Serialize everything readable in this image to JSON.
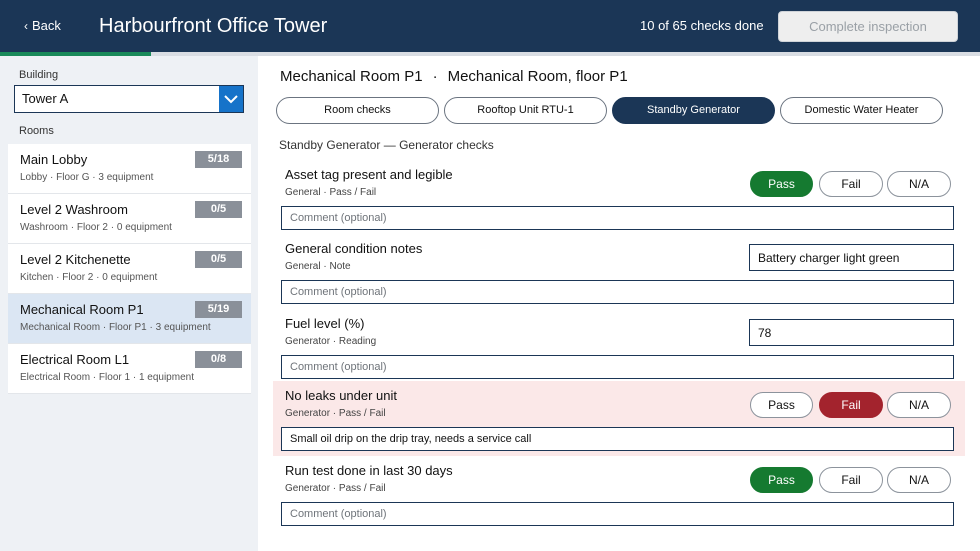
{
  "header": {
    "back_label": "Back",
    "title": "Harbourfront Office Tower",
    "checks_done": "10 of 65 checks done",
    "progress": 0.154,
    "complete_label": "Complete inspection"
  },
  "sidebar": {
    "building_label": "Building",
    "building_value": "Tower A",
    "rooms_label": "Rooms",
    "rooms": [
      {
        "name": "Main Lobby",
        "type": "Lobby",
        "floor": "Floor G",
        "equipment": "3 equipment",
        "count": "5/18"
      },
      {
        "name": "Level 2 Washroom",
        "type": "Washroom",
        "floor": "Floor 2",
        "equipment": "0 equipment",
        "count": "0/5"
      },
      {
        "name": "Level 2 Kitchenette",
        "type": "Kitchen",
        "floor": "Floor 2",
        "equipment": "0 equipment",
        "count": "0/5"
      },
      {
        "name": "Mechanical Room P1",
        "type": "Mechanical Room",
        "floor": "Floor P1",
        "equipment": "3 equipment",
        "count": "5/19"
      },
      {
        "name": "Electrical Room L1",
        "type": "Electrical Room",
        "floor": "Floor 1",
        "equipment": "1 equipment",
        "count": "0/8"
      }
    ]
  },
  "main": {
    "room_name": "Mechanical Room P1",
    "room_desc": "Mechanical Room, floor P1",
    "separator": "·",
    "tabs": [
      {
        "label": "Room checks"
      },
      {
        "label": "Rooftop Unit RTU-1"
      },
      {
        "label": "Standby Generator"
      },
      {
        "label": "Domestic Water Heater"
      }
    ],
    "section_title": "Standby Generator — Generator checks",
    "checks": [
      {
        "title": "Asset tag present and legible",
        "category": "General",
        "kind": "Pass / Fail",
        "pass": "Pass",
        "fail": "Fail",
        "na": "N/A",
        "comment_placeholder": "Comment (optional)"
      },
      {
        "title": "General condition notes",
        "category": "General",
        "kind": "Note",
        "value": "Battery charger light green",
        "comment_placeholder": "Comment (optional)"
      },
      {
        "title": "Fuel level (%)",
        "category": "Generator",
        "kind": "Reading",
        "value": "78",
        "comment_placeholder": "Comment (optional)"
      },
      {
        "title": "No leaks under unit",
        "category": "Generator",
        "kind": "Pass / Fail",
        "pass": "Pass",
        "fail": "Fail",
        "na": "N/A",
        "comment_value": "Small oil drip on the drip tray, needs a service call"
      },
      {
        "title": "Run test done in last 30 days",
        "category": "Generator",
        "kind": "Pass / Fail",
        "pass": "Pass",
        "fail": "Fail",
        "na": "N/A",
        "comment_placeholder": "Comment (optional)"
      }
    ]
  },
  "colors": {
    "header_bg": "#1b3656",
    "pass_selected": "#157a30",
    "fail_selected": "#a3232d",
    "failed_row_bg": "#fbe8e8",
    "progress_fill": "#1a8a5a"
  }
}
